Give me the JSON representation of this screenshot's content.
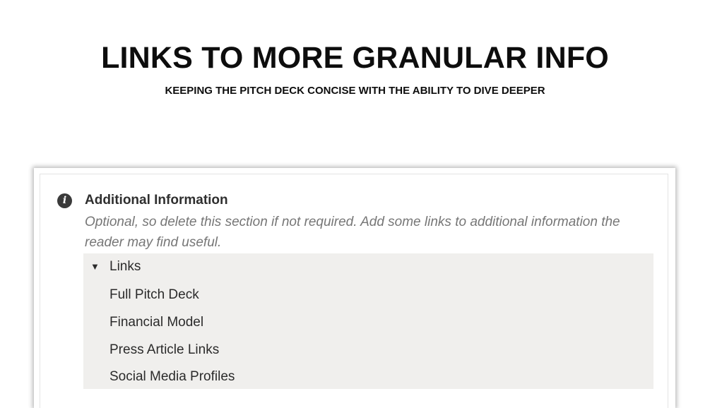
{
  "slide": {
    "title": "LINKS TO MORE GRANULAR INFO",
    "subtitle": "KEEPING THE PITCH DECK CONCISE WITH THE ABILITY TO DIVE DEEPER"
  },
  "callout": {
    "icon": "info-icon",
    "icon_glyph": "i",
    "heading": "Additional Information",
    "note": "Optional, so delete this section if not required. Add some links to additional information the reader may find useful.",
    "toggle": {
      "arrow": "▼",
      "label": "Links",
      "expanded": true,
      "items": [
        "Full Pitch Deck",
        "Financial Model",
        "Press Article Links",
        "Social Media Profiles"
      ]
    }
  },
  "colors": {
    "background": "#ffffff",
    "toggle_background": "#f0efed",
    "note_text": "#767676",
    "icon_fill": "#3a3a3a"
  }
}
